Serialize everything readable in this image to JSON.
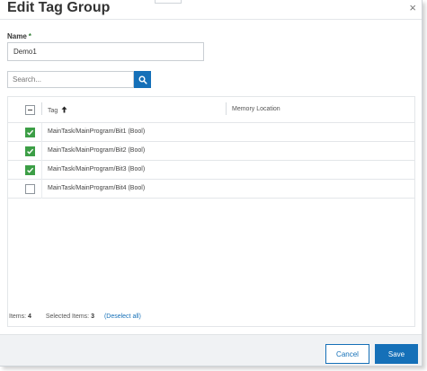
{
  "dialog": {
    "title": "Edit Tag Group",
    "close_glyph": "×"
  },
  "name_field": {
    "label": "Name",
    "required_marker": "*",
    "value": "Demo1"
  },
  "search": {
    "placeholder": "Search...",
    "button_icon": "search-icon"
  },
  "grid": {
    "header_checkbox_state": "indeterminate",
    "columns": [
      {
        "label": "Tag",
        "sort": "ascending",
        "sort_icon": "arrow-up-icon"
      },
      {
        "label": "Memory Location"
      }
    ],
    "rows": [
      {
        "tag": "MainTask/MainProgram/Bit1 (Bool)",
        "memory_location": "",
        "checked": true
      },
      {
        "tag": "MainTask/MainProgram/Bit2 (Bool)",
        "memory_location": "",
        "checked": true
      },
      {
        "tag": "MainTask/MainProgram/Bit3 (Bool)",
        "memory_location": "",
        "checked": true
      },
      {
        "tag": "MainTask/MainProgram/Bit4 (Bool)",
        "memory_location": "",
        "checked": false
      }
    ]
  },
  "footer": {
    "items_label": "Items:",
    "items_count": "4",
    "selected_label": "Selected Items:",
    "selected_count": "3",
    "deselect_all": "(Deselect all)"
  },
  "actions": {
    "cancel": "Cancel",
    "save": "Save"
  },
  "colors": {
    "accent": "#1570b8",
    "checkbox_checked": "#3c9e46",
    "required": "#2e7d32"
  }
}
